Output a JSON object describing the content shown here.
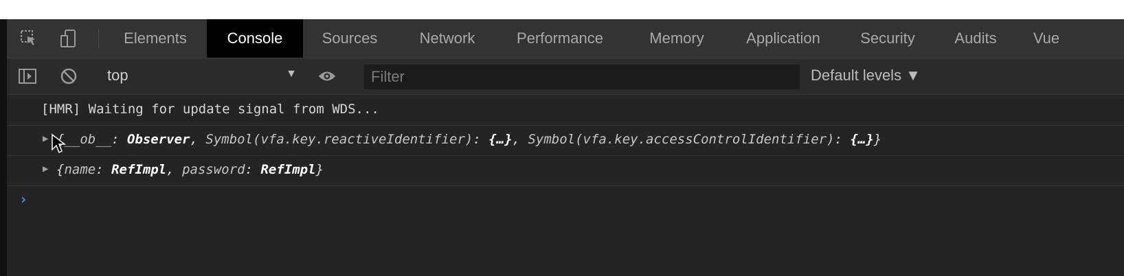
{
  "tabs": [
    {
      "label": "Elements"
    },
    {
      "label": "Console"
    },
    {
      "label": "Sources"
    },
    {
      "label": "Network"
    },
    {
      "label": "Performance"
    },
    {
      "label": "Memory"
    },
    {
      "label": "Application"
    },
    {
      "label": "Security"
    },
    {
      "label": "Audits"
    },
    {
      "label": "Vue"
    }
  ],
  "active_tab": "Console",
  "toolbar": {
    "context": "top",
    "filter_placeholder": "Filter",
    "levels_label": "Default levels ▼"
  },
  "console": {
    "messages": [
      {
        "text": "[HMR] Waiting for update signal from WDS..."
      },
      {
        "open": "{",
        "k1": "__ob__",
        "v1": "Observer",
        "k2": "Symbol(vfa.key.reactiveIdentifier)",
        "v2": "{…}",
        "k3": "Symbol(vfa.key.accessControlIdentifier)",
        "v3": "{…}",
        "close": "}"
      },
      {
        "open": "{",
        "k1": "name",
        "v1": "RefImpl",
        "k2": "password",
        "v2": "RefImpl",
        "close": "}"
      }
    ],
    "prompt_symbol": "›"
  },
  "colors": {
    "active_tab_bg": "#000000",
    "prompt": "#4c8df6",
    "panel_bg": "#242424"
  }
}
